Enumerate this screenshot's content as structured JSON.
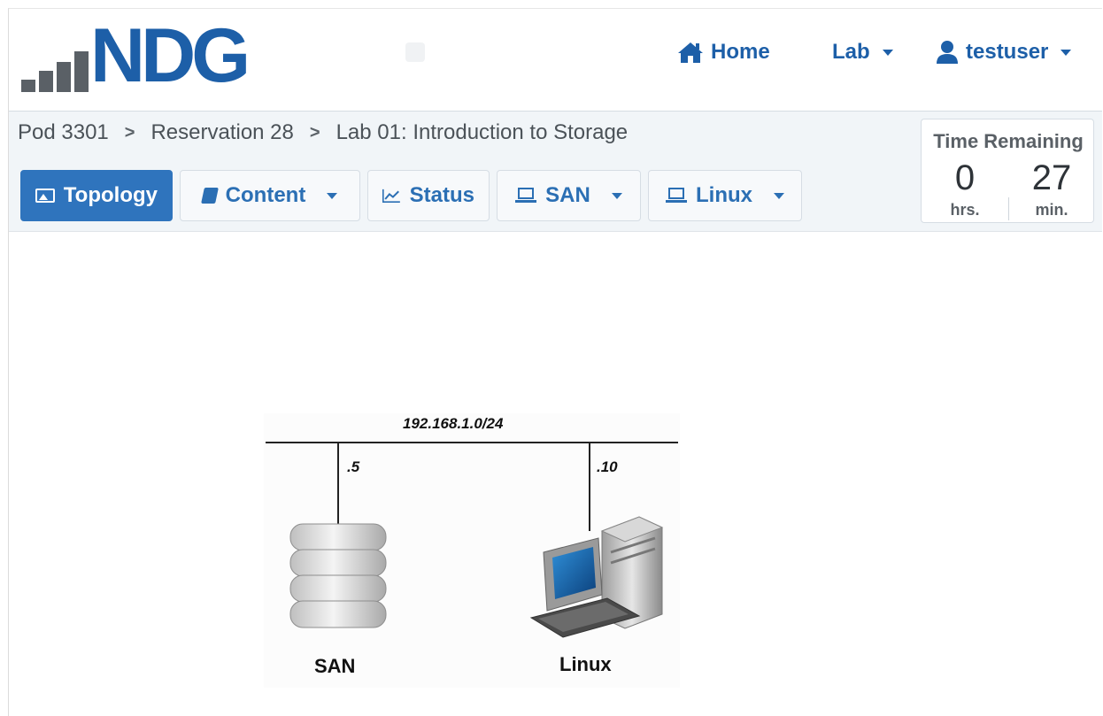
{
  "brand": {
    "logo_text": "NDG"
  },
  "nav": {
    "home_label": "Home",
    "lab_label": "Lab",
    "user_label": "testuser"
  },
  "breadcrumb": [
    "Pod 3301",
    "Reservation 28",
    "Lab 01: Introduction to Storage"
  ],
  "tabs": [
    {
      "label": "Topology",
      "icon": "image-icon",
      "active": true
    },
    {
      "label": "Content",
      "icon": "book-icon",
      "dropdown": true
    },
    {
      "label": "Status",
      "icon": "line-chart-icon"
    },
    {
      "label": "SAN",
      "icon": "laptop-icon",
      "dropdown": true
    },
    {
      "label": "Linux",
      "icon": "laptop-icon",
      "dropdown": true
    }
  ],
  "timer": {
    "title": "Time Remaining",
    "hours": "0",
    "hours_unit": "hrs.",
    "minutes": "27",
    "minutes_unit": "min."
  },
  "topology": {
    "network": "192.168.1.0/24",
    "nodes": [
      {
        "name": "SAN",
        "ip": ".5"
      },
      {
        "name": "Linux",
        "ip": ".10"
      }
    ]
  },
  "colors": {
    "brand_blue": "#1d5fa8",
    "active_tab": "#2f74bd",
    "toolbar_bg": "#f1f5f8"
  }
}
